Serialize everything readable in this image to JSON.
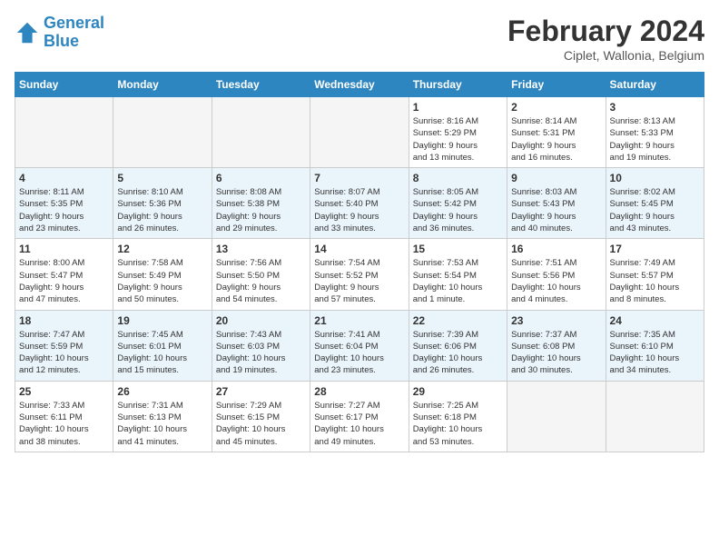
{
  "logo": {
    "line1": "General",
    "line2": "Blue"
  },
  "title": "February 2024",
  "location": "Ciplet, Wallonia, Belgium",
  "days_of_week": [
    "Sunday",
    "Monday",
    "Tuesday",
    "Wednesday",
    "Thursday",
    "Friday",
    "Saturday"
  ],
  "weeks": [
    [
      {
        "day": "",
        "info": ""
      },
      {
        "day": "",
        "info": ""
      },
      {
        "day": "",
        "info": ""
      },
      {
        "day": "",
        "info": ""
      },
      {
        "day": "1",
        "info": "Sunrise: 8:16 AM\nSunset: 5:29 PM\nDaylight: 9 hours\nand 13 minutes."
      },
      {
        "day": "2",
        "info": "Sunrise: 8:14 AM\nSunset: 5:31 PM\nDaylight: 9 hours\nand 16 minutes."
      },
      {
        "day": "3",
        "info": "Sunrise: 8:13 AM\nSunset: 5:33 PM\nDaylight: 9 hours\nand 19 minutes."
      }
    ],
    [
      {
        "day": "4",
        "info": "Sunrise: 8:11 AM\nSunset: 5:35 PM\nDaylight: 9 hours\nand 23 minutes."
      },
      {
        "day": "5",
        "info": "Sunrise: 8:10 AM\nSunset: 5:36 PM\nDaylight: 9 hours\nand 26 minutes."
      },
      {
        "day": "6",
        "info": "Sunrise: 8:08 AM\nSunset: 5:38 PM\nDaylight: 9 hours\nand 29 minutes."
      },
      {
        "day": "7",
        "info": "Sunrise: 8:07 AM\nSunset: 5:40 PM\nDaylight: 9 hours\nand 33 minutes."
      },
      {
        "day": "8",
        "info": "Sunrise: 8:05 AM\nSunset: 5:42 PM\nDaylight: 9 hours\nand 36 minutes."
      },
      {
        "day": "9",
        "info": "Sunrise: 8:03 AM\nSunset: 5:43 PM\nDaylight: 9 hours\nand 40 minutes."
      },
      {
        "day": "10",
        "info": "Sunrise: 8:02 AM\nSunset: 5:45 PM\nDaylight: 9 hours\nand 43 minutes."
      }
    ],
    [
      {
        "day": "11",
        "info": "Sunrise: 8:00 AM\nSunset: 5:47 PM\nDaylight: 9 hours\nand 47 minutes."
      },
      {
        "day": "12",
        "info": "Sunrise: 7:58 AM\nSunset: 5:49 PM\nDaylight: 9 hours\nand 50 minutes."
      },
      {
        "day": "13",
        "info": "Sunrise: 7:56 AM\nSunset: 5:50 PM\nDaylight: 9 hours\nand 54 minutes."
      },
      {
        "day": "14",
        "info": "Sunrise: 7:54 AM\nSunset: 5:52 PM\nDaylight: 9 hours\nand 57 minutes."
      },
      {
        "day": "15",
        "info": "Sunrise: 7:53 AM\nSunset: 5:54 PM\nDaylight: 10 hours\nand 1 minute."
      },
      {
        "day": "16",
        "info": "Sunrise: 7:51 AM\nSunset: 5:56 PM\nDaylight: 10 hours\nand 4 minutes."
      },
      {
        "day": "17",
        "info": "Sunrise: 7:49 AM\nSunset: 5:57 PM\nDaylight: 10 hours\nand 8 minutes."
      }
    ],
    [
      {
        "day": "18",
        "info": "Sunrise: 7:47 AM\nSunset: 5:59 PM\nDaylight: 10 hours\nand 12 minutes."
      },
      {
        "day": "19",
        "info": "Sunrise: 7:45 AM\nSunset: 6:01 PM\nDaylight: 10 hours\nand 15 minutes."
      },
      {
        "day": "20",
        "info": "Sunrise: 7:43 AM\nSunset: 6:03 PM\nDaylight: 10 hours\nand 19 minutes."
      },
      {
        "day": "21",
        "info": "Sunrise: 7:41 AM\nSunset: 6:04 PM\nDaylight: 10 hours\nand 23 minutes."
      },
      {
        "day": "22",
        "info": "Sunrise: 7:39 AM\nSunset: 6:06 PM\nDaylight: 10 hours\nand 26 minutes."
      },
      {
        "day": "23",
        "info": "Sunrise: 7:37 AM\nSunset: 6:08 PM\nDaylight: 10 hours\nand 30 minutes."
      },
      {
        "day": "24",
        "info": "Sunrise: 7:35 AM\nSunset: 6:10 PM\nDaylight: 10 hours\nand 34 minutes."
      }
    ],
    [
      {
        "day": "25",
        "info": "Sunrise: 7:33 AM\nSunset: 6:11 PM\nDaylight: 10 hours\nand 38 minutes."
      },
      {
        "day": "26",
        "info": "Sunrise: 7:31 AM\nSunset: 6:13 PM\nDaylight: 10 hours\nand 41 minutes."
      },
      {
        "day": "27",
        "info": "Sunrise: 7:29 AM\nSunset: 6:15 PM\nDaylight: 10 hours\nand 45 minutes."
      },
      {
        "day": "28",
        "info": "Sunrise: 7:27 AM\nSunset: 6:17 PM\nDaylight: 10 hours\nand 49 minutes."
      },
      {
        "day": "29",
        "info": "Sunrise: 7:25 AM\nSunset: 6:18 PM\nDaylight: 10 hours\nand 53 minutes."
      },
      {
        "day": "",
        "info": ""
      },
      {
        "day": "",
        "info": ""
      }
    ]
  ]
}
